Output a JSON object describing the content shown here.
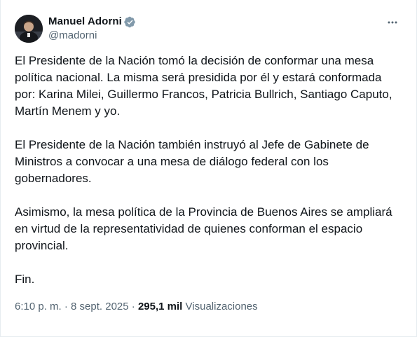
{
  "author": {
    "display_name": "Manuel Adorni",
    "handle": "@madorni",
    "verified": true
  },
  "post": {
    "paragraphs": [
      "El Presidente de la Nación tomó la decisión de conformar una mesa\npolítica nacional. La misma será presidida por él y estará conformada\npor: Karina Milei, Guillermo Francos, Patricia Bullrich, Santiago Caputo,\nMartín Menem y yo.",
      "El Presidente de la Nación también instruyó al Jefe de Gabinete de\nMinistros a convocar a una mesa de diálogo federal con los\ngobernadores.",
      "Asimismo, la mesa política de la Provincia de Buenos Aires se ampliará\nen virtud de la representatividad de quienes conforman el espacio\nprovincial.",
      "Fin."
    ]
  },
  "meta": {
    "time": "6:10 p. m.",
    "separator": "·",
    "date": "8 sept. 2025",
    "views_count": "295,1 mil",
    "views_label": "Visualizaciones"
  },
  "colors": {
    "text_primary": "#0f1419",
    "text_secondary": "#536471",
    "verified_badge": "#829aab"
  },
  "icons": {
    "verified": "verified-badge-icon",
    "more": "more-options-icon"
  }
}
